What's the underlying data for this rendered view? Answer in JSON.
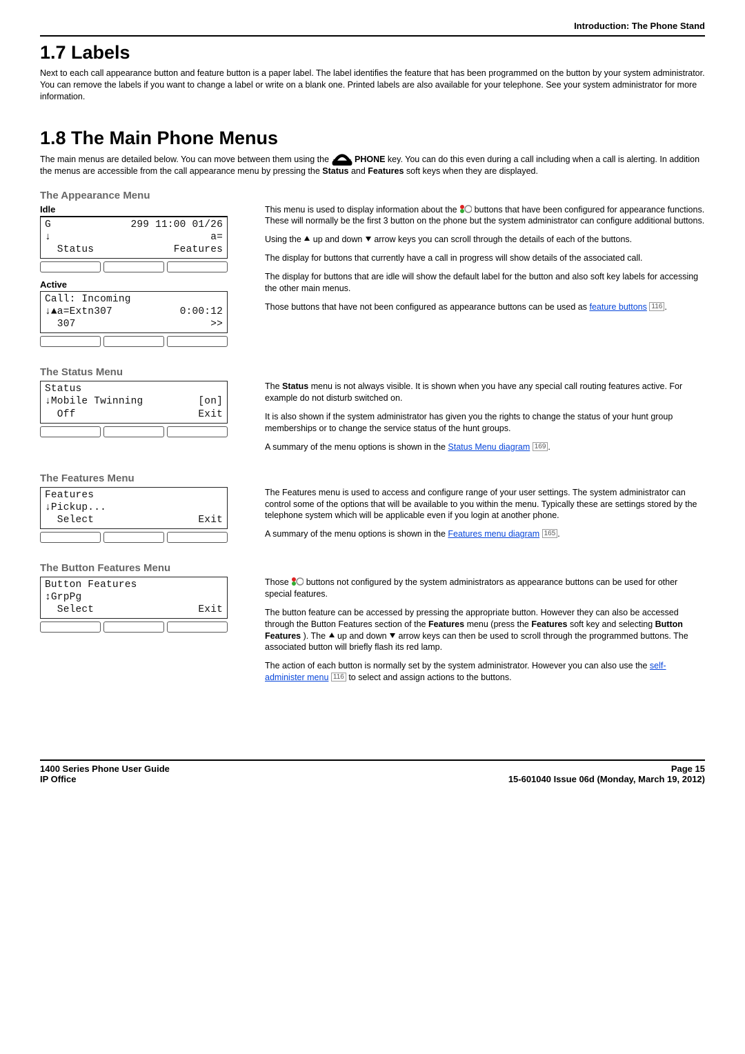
{
  "breadcrumb": "Introduction: The Phone Stand",
  "section_17": {
    "heading": "1.7 Labels",
    "body": "Next to each call appearance button and feature button is a paper label. The label identifies the feature that has been programmed on the button by your system administrator. You can remove the labels if you want to change a label or write on a blank one. Printed labels are also available for your telephone. See your system administrator for more information."
  },
  "section_18": {
    "heading": "1.8 The Main Phone Menus",
    "intro_a": "The main menus are detailed below. You can move between them using the ",
    "phone_key": "PHONE",
    "intro_b": " key. You can do this even during a call including when a call is alerting. In addition the menus are accessible from the call appearance menu by pressing the ",
    "status_key": "Status",
    "and": " and ",
    "features_key": "Features",
    "intro_c": " soft keys when they are displayed."
  },
  "appearance": {
    "title": "The Appearance Menu",
    "idle_label": "Idle",
    "idle_lcd": {
      "r1l": "G",
      "r1r": "299 11:00 01/26",
      "r2l": "↓",
      "r2r": "a=",
      "r3l": "  Status",
      "r3r": "Features"
    },
    "active_label": "Active",
    "active_lcd": {
      "r1l": "Call: Incoming",
      "r1r": "",
      "r2l": "↓▲a=Extn307",
      "r2r": "0:00:12",
      "r3l": "  307",
      "r3r": ">>"
    },
    "p1a": "This menu is used to display information about the ",
    "p1b": " buttons that have been configured for appearance functions. These will normally be the first 3 button on the phone but the system administrator can configure additional buttons.",
    "p2a": "Using the ",
    "p2b": " up and down ",
    "p2c": " arrow keys you can scroll through the details of each of the buttons.",
    "p3": "The display for buttons that currently have a call in progress will show details of the associated call.",
    "p4": "The display for buttons that are idle will show the default label for the button and also soft key labels for accessing the other main menus.",
    "p5a": "Those buttons that have not been configured as appearance buttons can be used as ",
    "p5_link": "feature buttons",
    "p5_ref": "116",
    "p5b": "."
  },
  "status": {
    "title": "The Status Menu",
    "lcd": {
      "r1l": "Status",
      "r1r": "",
      "r2l": "↓Mobile Twinning",
      "r2r": "[on]",
      "r3l": "  Off",
      "r3r": "Exit"
    },
    "p1a": "The ",
    "p1key": "Status",
    "p1b": " menu is not always visible. It is shown when you have any special call routing features active. For example do not disturb switched on.",
    "p2": "It is also shown if the system administrator has given you the rights to change the status of your hunt group memberships or to change the service status of the hunt groups.",
    "p3a": "A summary of the menu options is shown in the ",
    "p3_link": "Status Menu diagram",
    "p3_ref": "169",
    "p3b": "."
  },
  "features": {
    "title": "The Features Menu",
    "lcd": {
      "r1l": "Features",
      "r1r": "",
      "r2l": "↓Pickup...",
      "r2r": "",
      "r3l": "  Select",
      "r3r": "Exit"
    },
    "p1": "The Features menu is used to access and configure range of your user settings. The system administrator can control some of the options that will be available to you within the menu. Typically these are settings stored by the telephone system which will be applicable even if you login at another phone.",
    "p2a": "A summary of the menu options is shown in the ",
    "p2_link": "Features menu diagram",
    "p2_ref": "165",
    "p2b": "."
  },
  "button_features": {
    "title": "The Button Features Menu",
    "lcd": {
      "r1l": "Button Features",
      "r1r": "",
      "r2l": "↕GrpPg",
      "r2r": "",
      "r3l": "  Select",
      "r3r": "Exit"
    },
    "p1a": "Those ",
    "p1b": " buttons not configured by the system administrators as appearance buttons can be used for other special features.",
    "p2a": "The button feature can be accessed by pressing the appropriate button. However they can also be accessed through the Button Features section of the ",
    "p2_features": "Features",
    "p2b": " menu (press the ",
    "p2_features2": "Features",
    "p2c": " soft key and selecting ",
    "p2_bf": "Button Features",
    "p2d": "). The ",
    "p2e": " up and down ",
    "p2f": " arrow keys can then be used to scroll through the programmed buttons. The associated button will briefly flash its red lamp.",
    "p3a": "The action of each button is normally set by the system administrator. However you can also use the ",
    "p3_link": "self-administer menu",
    "p3_ref": "116",
    "p3b": " to select and assign actions to the buttons."
  },
  "footer": {
    "left1": "1400 Series Phone User Guide",
    "left2": "IP Office",
    "right1": "Page 15",
    "right2": "15-601040 Issue 06d (Monday, March 19, 2012)"
  }
}
